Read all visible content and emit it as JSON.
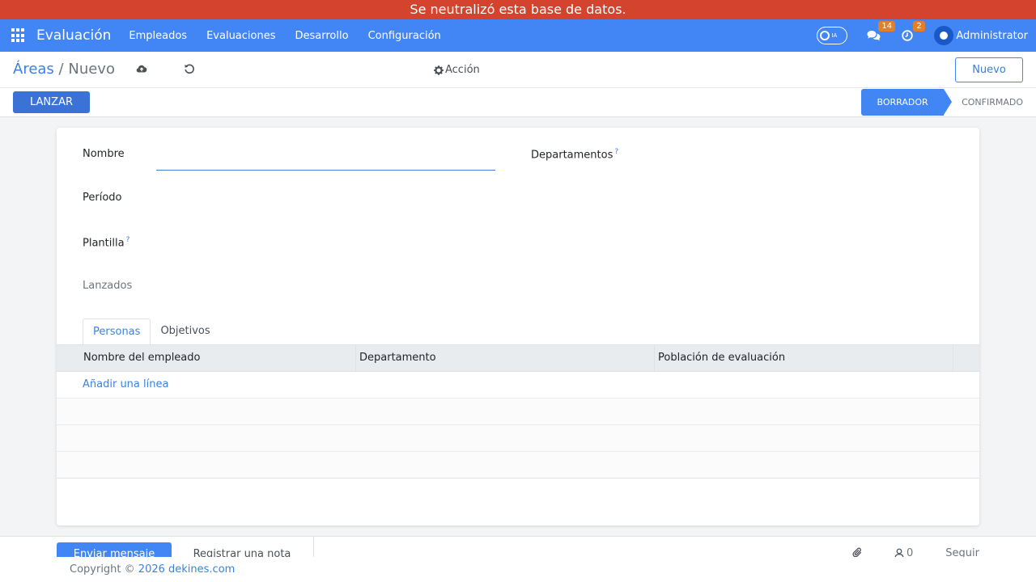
{
  "banner": {
    "text": "Se neutralizó esta base de datos."
  },
  "navbar": {
    "app_title": "Evaluación",
    "menu": [
      "Empleados",
      "Evaluaciones",
      "Desarrollo",
      "Configuración"
    ],
    "ai_label": "IA",
    "messages_count": "14",
    "activities_count": "2",
    "user_name": "Administrator"
  },
  "control_panel": {
    "breadcrumb_parent": "Áreas",
    "breadcrumb_sep": "/",
    "breadcrumb_current": "Nuevo",
    "action_label": "Acción",
    "new_button": "Nuevo",
    "launch_button": "LANZAR",
    "stages": [
      "BORRADOR",
      "CONFIRMADO"
    ]
  },
  "form": {
    "name_label": "Nombre",
    "name_value": "",
    "departments_label": "Departamentos",
    "period_label": "Período",
    "template_label": "Plantilla",
    "launched_label": "Lanzados",
    "help_mark": "?"
  },
  "tabs": [
    "Personas",
    "Objetivos"
  ],
  "table": {
    "columns": [
      "Nombre del empleado",
      "Departamento",
      "Población de evaluación"
    ],
    "add_line": "Añadir una línea"
  },
  "chatter": {
    "send_message": "Enviar mensaje",
    "log_note": "Registrar una nota",
    "followers_count": "0",
    "follow": "Seguir"
  },
  "footer": {
    "copyright": "Copyright ©",
    "link_text": "2026 dekines.com"
  },
  "colors": {
    "banner": "#d4432d",
    "navbar": "#4285f4",
    "primary": "#3a72d6",
    "badge": "#e67e22"
  }
}
